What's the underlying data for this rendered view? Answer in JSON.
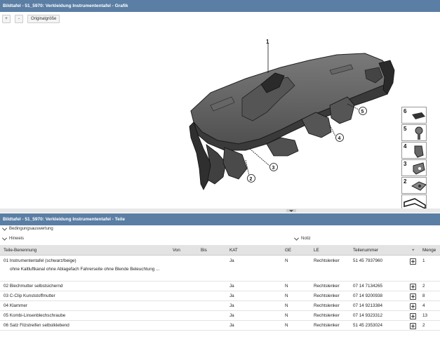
{
  "graphic_panel": {
    "title": "Bildtafel - 51_5970: Verkleidung Instrumententafel - Grafik",
    "toolbar": {
      "zoom_in": "+",
      "zoom_out": "-",
      "original_size": "Originalgröße"
    },
    "callouts": [
      "1",
      "2",
      "3",
      "4",
      "5"
    ],
    "thumbnails": [
      "6",
      "5",
      "4",
      "3",
      "2",
      ""
    ]
  },
  "parts_panel": {
    "title": "Bildtafel - 51_5970: Verkleidung Instrumententafel - Teile",
    "filters": {
      "condition": "Bedingungsauswertung",
      "hint": "Hinweis",
      "note": "Notiz"
    },
    "columns": {
      "name": "Teile-Benennung",
      "von": "Von",
      "bis": "Bis",
      "kat": "KAT",
      "ge": "GE",
      "le": "LE",
      "nr": "Teilenummer",
      "plus": "+",
      "menge": "Menge"
    },
    "rows": [
      {
        "name": "01 Instrumententafel (schwarz/beige)",
        "kat": "Ja",
        "ge": "N",
        "le": "Rechtslenker",
        "nr": "51 45 7937960",
        "menge": "1",
        "note": "ohne Kaltluftkanal ohne Ablagefach Fahrerseite ohne Blende Beleuchtung ..."
      },
      {
        "name": "02 Blechmutter selbstsichernd",
        "kat": "Ja",
        "ge": "N",
        "le": "Rechtslenker",
        "nr": "07 14 7134265",
        "menge": "2"
      },
      {
        "name": "03 C-Clip Kunststoffmutter",
        "kat": "Ja",
        "ge": "N",
        "le": "Rechtslenker",
        "nr": "07 14 9200938",
        "menge": "8"
      },
      {
        "name": "04 Klammer",
        "kat": "Ja",
        "ge": "N",
        "le": "Rechtslenker",
        "nr": "07 14 9213384",
        "menge": "4"
      },
      {
        "name": "05 Kombi-Linsenblechschraube",
        "kat": "Ja",
        "ge": "N",
        "le": "Rechtslenker",
        "nr": "07 14 9323312",
        "menge": "13"
      },
      {
        "name": "06 Satz Filzstreifen selbstklebend",
        "kat": "Ja",
        "ge": "N",
        "le": "Rechtslenker",
        "nr": "51 45 2353024",
        "menge": "2"
      }
    ]
  }
}
